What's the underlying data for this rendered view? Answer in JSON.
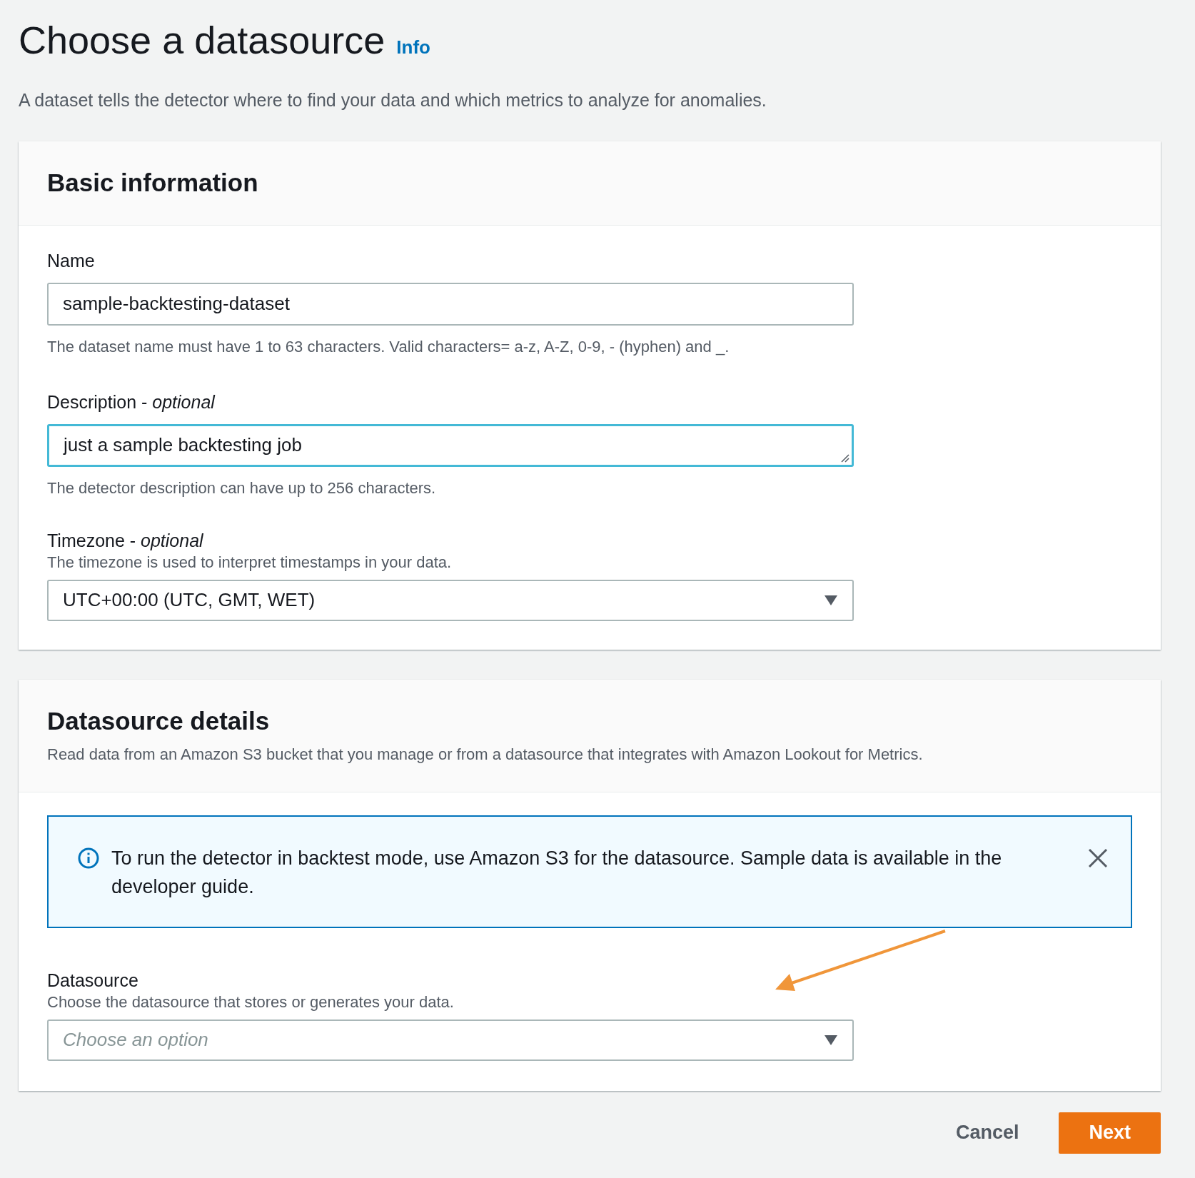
{
  "page": {
    "title": "Choose a datasource",
    "info_link": "Info",
    "description": "A dataset tells the detector where to find your data and which metrics to analyze for anomalies."
  },
  "basic_information": {
    "heading": "Basic information",
    "fields": [
      {
        "kind": "input",
        "label": "Name",
        "value": "sample-backtesting-dataset",
        "hint": "The dataset name must have 1 to 63 characters. Valid characters= a-z, A-Z, 0-9, - (hyphen) and _.",
        "focused": false
      },
      {
        "kind": "textarea",
        "label": "Description - *optional*",
        "value": "just a sample backtesting job",
        "hint": "The detector description can have up to 256 characters.",
        "focused": true
      },
      {
        "kind": "select",
        "label": "Timezone - *optional*",
        "description": "The timezone is used to interpret timestamps in your data.",
        "value": "UTC+00:00 (UTC, GMT, WET)",
        "focused": false
      }
    ]
  },
  "datasource_details": {
    "heading": "Datasource details",
    "description": "Read data from an Amazon S3 bucket that you manage or from a datasource that integrates with Amazon Lookout for Metrics.",
    "alert": {
      "text": "To run the detector in backtest mode, use Amazon S3 for the datasource. Sample data is available in the developer guide."
    },
    "fields": [
      {
        "kind": "select",
        "label": "Datasource",
        "description": "Choose the datasource that stores or generates your data.",
        "placeholder": "Choose an option",
        "focused": false
      }
    ]
  },
  "buttons": [
    {
      "kind": "link",
      "label": "Cancel"
    },
    {
      "kind": "primary",
      "label": "Next"
    }
  ]
}
